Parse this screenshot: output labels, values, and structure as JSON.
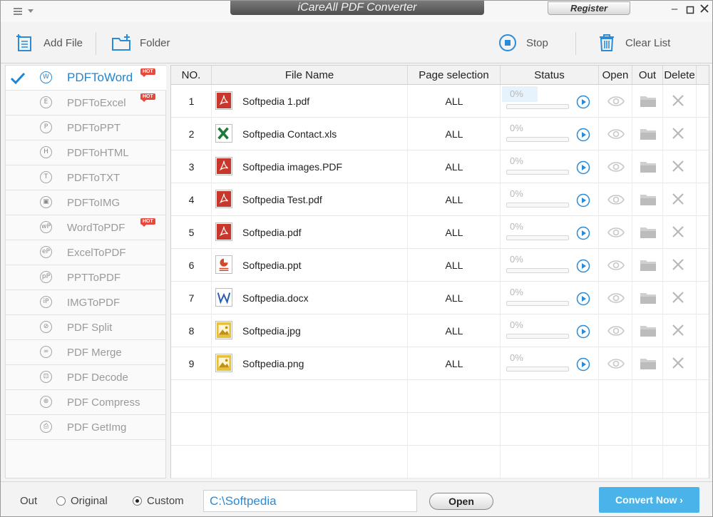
{
  "app": {
    "title": "iCareAll PDF Converter",
    "register_label": "Register"
  },
  "toolbar": {
    "add_file": "Add File",
    "folder": "Folder",
    "stop": "Stop",
    "clear_list": "Clear List"
  },
  "sidebar": {
    "items": [
      {
        "label": "PDFToWord",
        "icon": "W",
        "hot": "HOT",
        "active": true
      },
      {
        "label": "PDFToExcel",
        "icon": "E",
        "hot": "HOT"
      },
      {
        "label": "PDFToPPT",
        "icon": "P"
      },
      {
        "label": "PDFToHTML",
        "icon": "H"
      },
      {
        "label": "PDFToTXT",
        "icon": "T"
      },
      {
        "label": "PDFToIMG",
        "icon": "▣"
      },
      {
        "label": "WordToPDF",
        "icon": "wP",
        "hot": "HOT"
      },
      {
        "label": "ExcelToPDF",
        "icon": "eP"
      },
      {
        "label": "PPTToPDF",
        "icon": "pP"
      },
      {
        "label": "IMGToPDF",
        "icon": "iP"
      },
      {
        "label": "PDF Split",
        "icon": "⊘"
      },
      {
        "label": "PDF Merge",
        "icon": "∞"
      },
      {
        "label": "PDF Decode",
        "icon": "⊡"
      },
      {
        "label": "PDF Compress",
        "icon": "⊛"
      },
      {
        "label": "PDF GetImg",
        "icon": "⎙"
      }
    ]
  },
  "table": {
    "headers": {
      "no": "NO.",
      "name": "File Name",
      "pages": "Page selection",
      "status": "Status",
      "open": "Open",
      "out": "Out",
      "delete": "Delete"
    },
    "rows": [
      {
        "no": "1",
        "name": "Softpedia 1.pdf",
        "type": "pdf",
        "pages": "ALL",
        "status": "0%"
      },
      {
        "no": "2",
        "name": "Softpedia Contact.xls",
        "type": "xls",
        "pages": "ALL",
        "status": "0%"
      },
      {
        "no": "3",
        "name": "Softpedia images.PDF",
        "type": "pdf",
        "pages": "ALL",
        "status": "0%"
      },
      {
        "no": "4",
        "name": "Softpedia Test.pdf",
        "type": "pdf",
        "pages": "ALL",
        "status": "0%"
      },
      {
        "no": "5",
        "name": "Softpedia.pdf",
        "type": "pdf",
        "pages": "ALL",
        "status": "0%"
      },
      {
        "no": "6",
        "name": "Softpedia.ppt",
        "type": "ppt",
        "pages": "ALL",
        "status": "0%"
      },
      {
        "no": "7",
        "name": "Softpedia.docx",
        "type": "doc",
        "pages": "ALL",
        "status": "0%"
      },
      {
        "no": "8",
        "name": "Softpedia.jpg",
        "type": "img",
        "pages": "ALL",
        "status": "0%"
      },
      {
        "no": "9",
        "name": "Softpedia.png",
        "type": "img",
        "pages": "ALL",
        "status": "0%"
      }
    ]
  },
  "bottom": {
    "out_label": "Out",
    "original_label": "Original",
    "custom_label": "Custom",
    "selected_option": "Custom",
    "output_path": "C:\\Softpedia",
    "open_label": "Open",
    "convert_label": "Convert Now ›"
  },
  "colors": {
    "accent": "#1e86d6",
    "convert": "#4ab4ea",
    "hot": "#e8493c"
  }
}
